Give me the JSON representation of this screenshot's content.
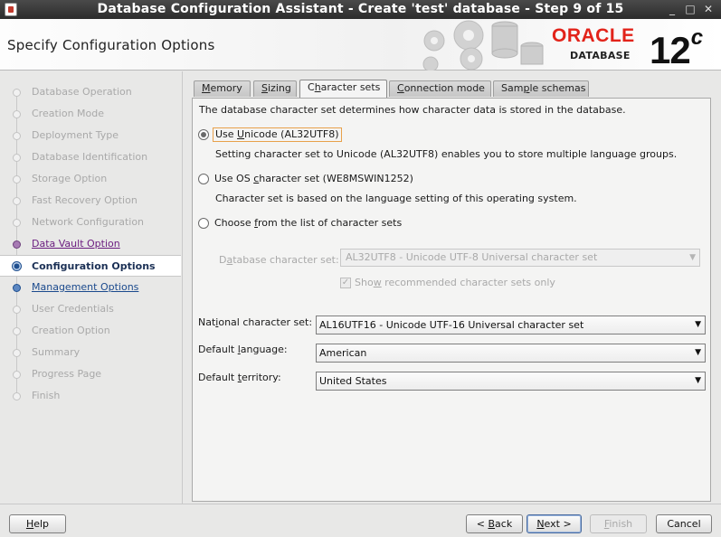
{
  "window": {
    "title": "Database Configuration Assistant - Create 'test' database - Step 9 of 15",
    "minimize_glyph": "_",
    "maximize_glyph": "□",
    "close_glyph": "✕"
  },
  "header": {
    "page_title": "Specify Configuration Options",
    "brand": "ORACLE",
    "brand_sub": "DATABASE",
    "version": "12",
    "version_suffix": "c"
  },
  "nav": {
    "items": [
      {
        "label": "Database Operation",
        "state": "disabled"
      },
      {
        "label": "Creation Mode",
        "state": "disabled"
      },
      {
        "label": "Deployment Type",
        "state": "disabled"
      },
      {
        "label": "Database Identification",
        "state": "disabled"
      },
      {
        "label": "Storage Option",
        "state": "disabled"
      },
      {
        "label": "Fast Recovery Option",
        "state": "disabled"
      },
      {
        "label": "Network Configuration",
        "state": "disabled"
      },
      {
        "label": "Data Vault Option",
        "state": "visited"
      },
      {
        "label": "Configuration Options",
        "state": "current"
      },
      {
        "label": "Management Options",
        "state": "link"
      },
      {
        "label": "User Credentials",
        "state": "disabled"
      },
      {
        "label": "Creation Option",
        "state": "disabled"
      },
      {
        "label": "Summary",
        "state": "disabled"
      },
      {
        "label": "Progress Page",
        "state": "disabled"
      },
      {
        "label": "Finish",
        "state": "disabled"
      }
    ]
  },
  "tabs": {
    "memory": {
      "pre": "",
      "key": "M",
      "post": "emory"
    },
    "sizing": {
      "pre": "",
      "key": "S",
      "post": "izing"
    },
    "charsets": {
      "pre": "C",
      "key": "h",
      "post": "aracter sets"
    },
    "connection": {
      "pre": "",
      "key": "C",
      "post": "onnection mode"
    },
    "samples": {
      "pre": "Sam",
      "key": "p",
      "post": "le schemas"
    },
    "active": "Character sets"
  },
  "charsets": {
    "intro": "The database character set determines how character data is stored in the database.",
    "unicode": {
      "pre": "Use ",
      "key": "U",
      "post": "nicode (AL32UTF8)",
      "help": "Setting character set to Unicode (AL32UTF8) enables you to store multiple language groups.",
      "selected": true
    },
    "os": {
      "pre": "Use OS ",
      "key": "c",
      "post": "haracter set (WE8MSWIN1252)",
      "help": "Character set is based on the language setting of this operating system.",
      "selected": false
    },
    "choose": {
      "pre": "Choose ",
      "key": "f",
      "post": "rom the list of character sets",
      "selected": false
    },
    "db_charset": {
      "label_pre": "D",
      "label_key": "a",
      "label_post": "tabase character set:",
      "value": "AL32UTF8 - Unicode UTF-8 Universal character set"
    },
    "recommended": {
      "pre": "Sho",
      "key": "w",
      "post": " recommended character sets only",
      "checked": true
    }
  },
  "fields": {
    "national": {
      "label_pre": "Nat",
      "label_key": "i",
      "label_post": "onal character set:",
      "value": "AL16UTF16 - Unicode UTF-16 Universal character set"
    },
    "language": {
      "label_pre": "Default ",
      "label_key": "l",
      "label_post": "anguage:",
      "value": "American"
    },
    "territory": {
      "label_pre": "Default ",
      "label_key": "t",
      "label_post": "erritory:",
      "value": "United States"
    }
  },
  "footer": {
    "help": {
      "pre": "",
      "key": "H",
      "post": "elp"
    },
    "back": {
      "pre": "< ",
      "key": "B",
      "post": "ack"
    },
    "next": {
      "pre": "",
      "key": "N",
      "post": "ext >"
    },
    "finish": {
      "pre": "",
      "key": "F",
      "post": "inish"
    },
    "cancel": "Cancel"
  },
  "colors": {
    "brand_red": "#e2231a",
    "link_blue": "#1b4a8d",
    "visited_purple": "#6a1c7f",
    "focus_orange": "#e8a14b"
  },
  "icons": {
    "app": "java-app-icon",
    "header_art": "gears-and-database-icon"
  }
}
